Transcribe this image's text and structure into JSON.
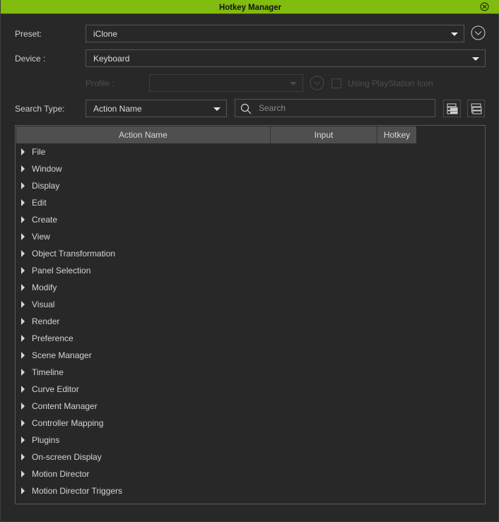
{
  "window": {
    "title": "Hotkey Manager",
    "accent_color": "#82bc0e"
  },
  "form": {
    "preset_label": "Preset:",
    "preset_value": "iClone",
    "device_label": "Device :",
    "device_value": "Keyboard",
    "profile_label": "Profile :",
    "profile_value": "",
    "playstation_label": "Using PlayStation Icon",
    "playstation_checked": false,
    "search_type_label": "Search Type:",
    "search_type_value": "Action Name",
    "search_placeholder": "Search",
    "search_value": ""
  },
  "table": {
    "columns": [
      "Action Name",
      "Input",
      "Hotkey"
    ],
    "rows": [
      "File",
      "Window",
      "Display",
      "Edit",
      "Create",
      "View",
      "Object Transformation",
      "Panel Selection",
      "Modify",
      "Visual",
      "Render",
      "Preference",
      "Scene Manager",
      "Timeline",
      "Curve Editor",
      "Content Manager",
      "Controller Mapping",
      "Plugins",
      "On-screen Display",
      "Motion Director",
      "Motion Director Triggers"
    ]
  },
  "icons": {
    "close": "close-circle-icon",
    "preset_menu": "chevron-down-circle-icon",
    "profile_menu": "chevron-down-circle-icon",
    "search": "search-icon",
    "expand_all": "expand-all-icon",
    "collapse_all": "collapse-all-icon",
    "row_expander": "triangle-right-icon"
  }
}
